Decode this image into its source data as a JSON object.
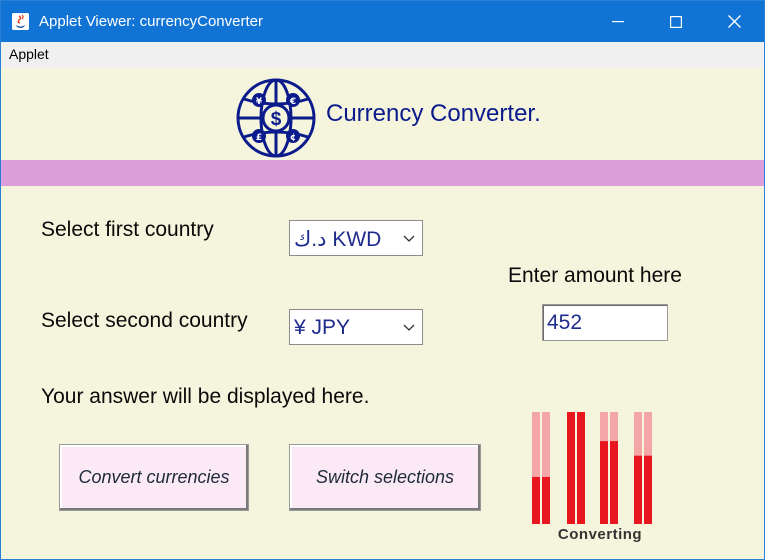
{
  "window": {
    "title": "Applet Viewer: currencyConverter",
    "titlebar_color": "#1174d4",
    "controls": [
      "minimize-icon",
      "maximize-icon",
      "close-icon"
    ]
  },
  "menu": {
    "items": [
      "Applet"
    ]
  },
  "header": {
    "title": "Currency Converter.",
    "logo_icon": "globe-currency-icon",
    "band_color": "#dc9fdc"
  },
  "form": {
    "first_country_label": "Select first country",
    "first_country_value": "د.ك KWD",
    "second_country_label": "Select second country",
    "second_country_value": "¥ JPY",
    "amount_label": "Enter amount here",
    "amount_value": "452",
    "answer_text": "Your answer will be displayed here."
  },
  "buttons": {
    "convert": "Convert currencies",
    "switch": "Switch selections"
  },
  "loader": {
    "label": "Converting",
    "fill_levels": [
      0.42,
      1.0,
      0.74,
      0.61
    ],
    "bar_color": "#e8161f",
    "track_color": "#f4a6a6"
  },
  "colors": {
    "background": "#f5f4dc",
    "title_text": "#0b1b8c",
    "button_bg": "#fbe9f5"
  }
}
